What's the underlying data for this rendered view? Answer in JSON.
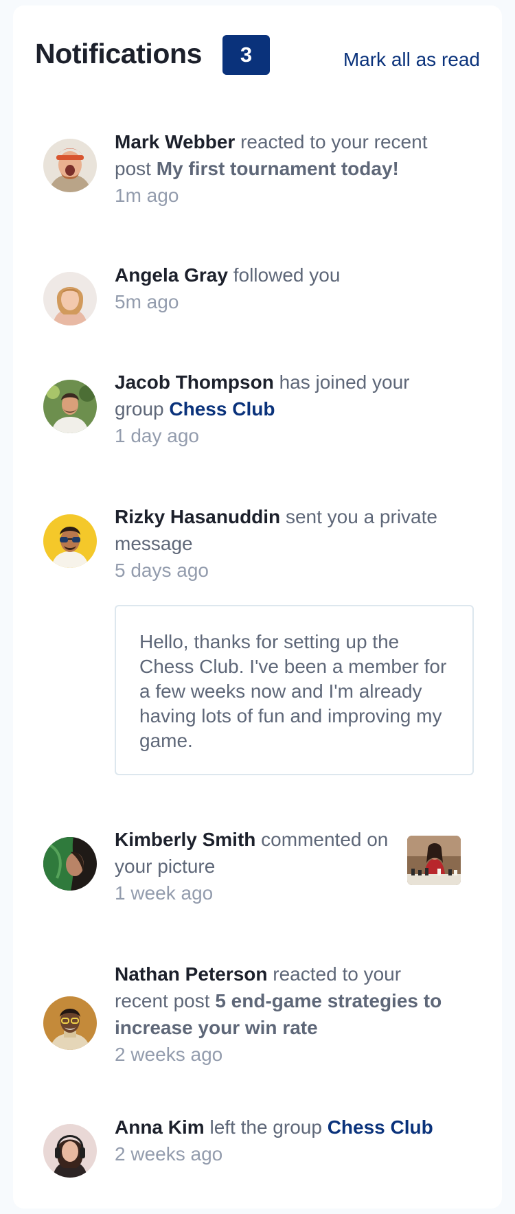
{
  "header": {
    "title": "Notifications",
    "unread_count": "3",
    "mark_all_label": "Mark all as read"
  },
  "notifications": [
    {
      "name": "Mark Webber",
      "action": " reacted to your recent post ",
      "post": "My first tournament today!",
      "time": "1m ago",
      "avatar": "avatar-mark-webber"
    },
    {
      "name": "Angela Gray",
      "action": " followed you",
      "time": "5m ago",
      "avatar": "avatar-angela-gray"
    },
    {
      "name": "Jacob Thompson",
      "action": " has joined your group ",
      "group": "Chess Club",
      "time": "1 day ago",
      "avatar": "avatar-jacob-thompson"
    },
    {
      "name": "Rizky Hasanuddin",
      "action": " sent you a private message",
      "time": "5 days ago",
      "message": "Hello, thanks for setting up the Chess Club. I've been a member for a few weeks now and I'm already having lots of fun and improving my game.",
      "avatar": "avatar-rizky-hasanuddin"
    },
    {
      "name": "Kimberly Smith",
      "action": " commented on your picture",
      "time": "1 week ago",
      "avatar": "avatar-kimberly-smith",
      "picture": "chess-picture-thumbnail"
    },
    {
      "name": "Nathan Peterson",
      "action": " reacted to your recent post ",
      "post": "5 end-game strategies to increase your win rate",
      "time": "2 weeks ago",
      "avatar": "avatar-nathan-peterson"
    },
    {
      "name": "Anna Kim",
      "action": " left the group ",
      "group": "Chess Club",
      "time": "2 weeks ago",
      "avatar": "avatar-anna-kim"
    }
  ],
  "colors": {
    "accent": "#0a327b",
    "heading": "#1c202b",
    "body_text": "#5e6778",
    "muted": "#939cad",
    "page_bg": "#f7fafd"
  }
}
